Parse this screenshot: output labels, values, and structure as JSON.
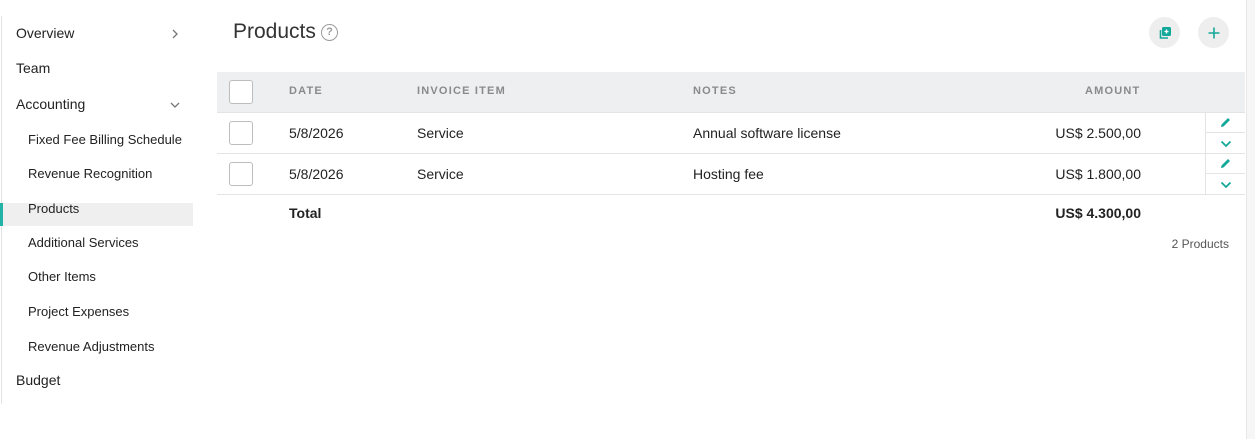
{
  "sidebar": {
    "items": [
      {
        "label": "Overview"
      },
      {
        "label": "Team"
      },
      {
        "label": "Accounting"
      },
      {
        "label": "Budget"
      }
    ],
    "accounting_children": [
      {
        "label": "Fixed Fee Billing Schedule"
      },
      {
        "label": "Revenue Recognition"
      },
      {
        "label": "Products"
      },
      {
        "label": "Additional Services"
      },
      {
        "label": "Other Items"
      },
      {
        "label": "Project Expenses"
      },
      {
        "label": "Revenue Adjustments"
      }
    ],
    "active_item": "Products",
    "accent_color": "#22b3a6"
  },
  "page": {
    "title": "Products",
    "help_glyph": "?"
  },
  "table": {
    "columns": {
      "date": "DATE",
      "item": "INVOICE ITEM",
      "notes": "NOTES",
      "amount": "AMOUNT"
    },
    "rows": [
      {
        "date": "5/8/2026",
        "item": "Service",
        "notes": "Annual software license",
        "amount": "US$ 2.500,00"
      },
      {
        "date": "5/8/2026",
        "item": "Service",
        "notes": "Hosting fee",
        "amount": "US$ 1.800,00"
      }
    ],
    "total_label": "Total",
    "total_amount": "US$ 4.300,00",
    "count_text": "2 Products"
  },
  "icons": {
    "copy": "copy-icon",
    "add": "plus-icon",
    "edit": "pencil-icon",
    "expand": "chevron-down-icon"
  }
}
